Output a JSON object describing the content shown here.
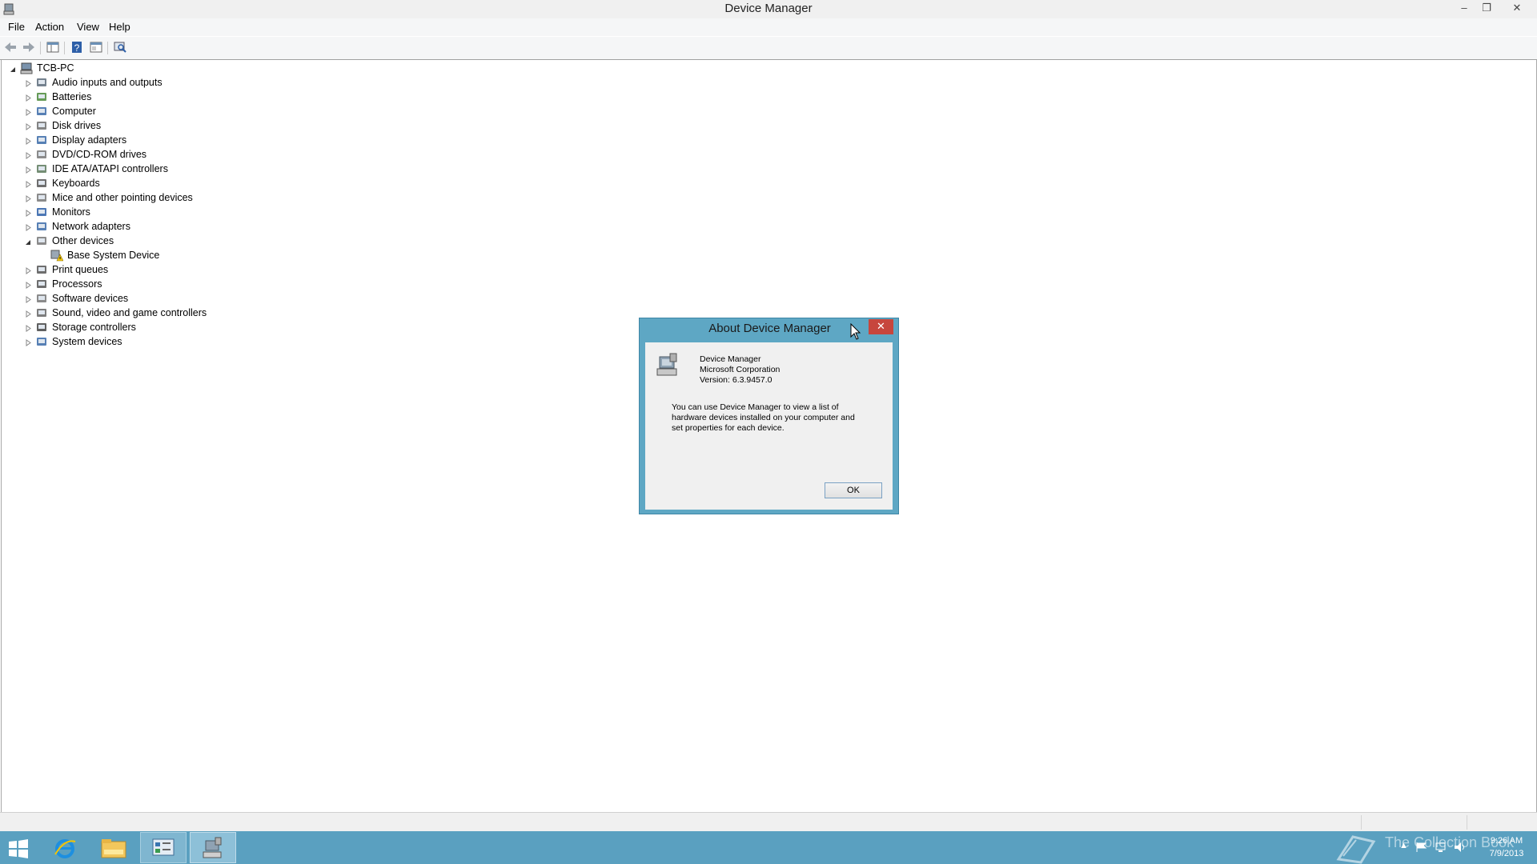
{
  "window": {
    "title": "Device Manager",
    "minimize_icon": "minimize-icon",
    "restore_icon": "restore-icon",
    "close_icon": "close-icon"
  },
  "menu": {
    "items": [
      "File",
      "Action",
      "View",
      "Help"
    ]
  },
  "toolbar": {
    "buttons": [
      "back-icon",
      "forward-icon",
      "show-hide-console-tree-icon",
      "help-icon",
      "properties-icon",
      "scan-hardware-icon"
    ]
  },
  "tree": {
    "root": "TCB-PC",
    "categories": [
      {
        "label": "Audio inputs and outputs",
        "icon": "speaker-icon",
        "expanded": false
      },
      {
        "label": "Batteries",
        "icon": "battery-icon",
        "expanded": false
      },
      {
        "label": "Computer",
        "icon": "computer-icon",
        "expanded": false
      },
      {
        "label": "Disk drives",
        "icon": "disk-drive-icon",
        "expanded": false
      },
      {
        "label": "Display adapters",
        "icon": "display-adapter-icon",
        "expanded": false
      },
      {
        "label": "DVD/CD-ROM drives",
        "icon": "dvd-drive-icon",
        "expanded": false
      },
      {
        "label": "IDE ATA/ATAPI controllers",
        "icon": "ide-controller-icon",
        "expanded": false
      },
      {
        "label": "Keyboards",
        "icon": "keyboard-icon",
        "expanded": false
      },
      {
        "label": "Mice and other pointing devices",
        "icon": "mouse-icon",
        "expanded": false
      },
      {
        "label": "Monitors",
        "icon": "monitor-icon",
        "expanded": false
      },
      {
        "label": "Network adapters",
        "icon": "network-adapter-icon",
        "expanded": false
      },
      {
        "label": "Other devices",
        "icon": "other-devices-icon",
        "expanded": true
      },
      {
        "label": "Print queues",
        "icon": "printer-icon",
        "expanded": false
      },
      {
        "label": "Processors",
        "icon": "processor-icon",
        "expanded": false
      },
      {
        "label": "Software devices",
        "icon": "software-device-icon",
        "expanded": false
      },
      {
        "label": "Sound, video and game controllers",
        "icon": "sound-controller-icon",
        "expanded": false
      },
      {
        "label": "Storage controllers",
        "icon": "storage-controller-icon",
        "expanded": false
      },
      {
        "label": "System devices",
        "icon": "system-devices-icon",
        "expanded": false
      }
    ],
    "child": {
      "label": "Base System Device",
      "icon": "warning-device-icon"
    }
  },
  "dialog": {
    "title": "About Device Manager",
    "product": "Device Manager",
    "company": "Microsoft Corporation",
    "version": "Version: 6.3.9457.0",
    "description_lines": [
      "You can use Device Manager to view a list of",
      "hardware devices installed on your computer and",
      "set properties for each device."
    ],
    "ok_label": "OK",
    "icon": "device-manager-icon"
  },
  "taskbar": {
    "items": [
      "start-icon",
      "internet-explorer-icon",
      "file-explorer-icon",
      "control-panel-icon",
      "device-manager-icon"
    ],
    "watermark": "The Collection Book",
    "time": "9:26 AM",
    "date": "7/9/2013"
  },
  "colors": {
    "dialog_frame": "#5ea7c4",
    "taskbar": "#5aa0c0",
    "close_red": "#c7463d"
  }
}
